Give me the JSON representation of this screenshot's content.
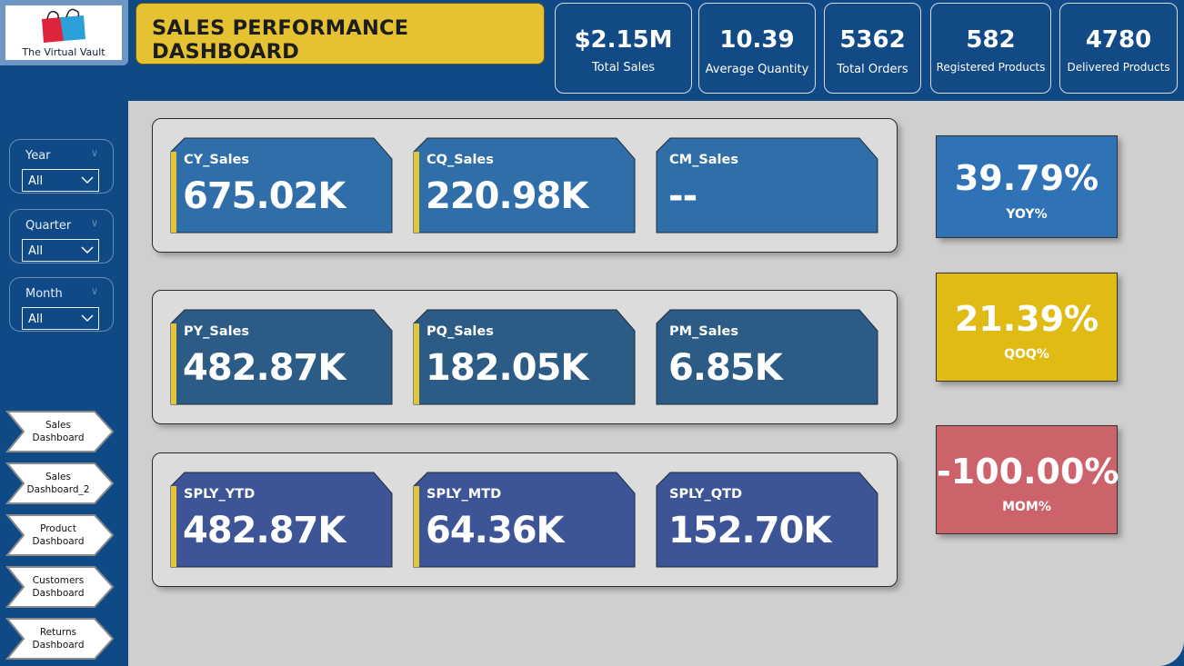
{
  "brand": {
    "name": "The Virtual Vault"
  },
  "title": "SALES PERFORMANCE DASHBOARD",
  "kpis": [
    {
      "value": "$2.15M",
      "label": "Total Sales"
    },
    {
      "value": "10.39",
      "label": "Average Quantity"
    },
    {
      "value": "5362",
      "label": "Total Orders"
    },
    {
      "value": "582",
      "label": "Registered Products"
    },
    {
      "value": "4780",
      "label": "Delivered Products"
    }
  ],
  "slicers": [
    {
      "title": "Year",
      "value": "All"
    },
    {
      "title": "Quarter",
      "value": "All"
    },
    {
      "title": "Month",
      "value": "All"
    }
  ],
  "nav": [
    {
      "line1": "Sales",
      "line2": "Dashboard"
    },
    {
      "line1": "Sales",
      "line2": "Dashboard_2"
    },
    {
      "line1": "Product",
      "line2": "Dashboard"
    },
    {
      "line1": "Customers",
      "line2": "Dashboard"
    },
    {
      "line1": "Returns",
      "line2": "Dashboard"
    }
  ],
  "rows": [
    {
      "cards": [
        {
          "label": "CY_Sales",
          "value": "675.02K"
        },
        {
          "label": "CQ_Sales",
          "value": "220.98K"
        },
        {
          "label": "CM_Sales",
          "value": "--"
        }
      ]
    },
    {
      "cards": [
        {
          "label": "PY_Sales",
          "value": "482.87K"
        },
        {
          "label": "PQ_Sales",
          "value": "182.05K"
        },
        {
          "label": "PM_Sales",
          "value": "6.85K"
        }
      ]
    },
    {
      "cards": [
        {
          "label": "SPLY_YTD",
          "value": "482.87K"
        },
        {
          "label": "SPLY_MTD",
          "value": "64.36K"
        },
        {
          "label": "SPLY_QTD",
          "value": "152.70K"
        }
      ]
    }
  ],
  "percentages": [
    {
      "value": "39.79%",
      "label": "YOY%"
    },
    {
      "value": "21.39%",
      "label": "QOQ%"
    },
    {
      "value": "-100.00%",
      "label": "MOM%"
    }
  ],
  "colors": {
    "background": "#104a86",
    "title_bg": "#e5c232",
    "row1_card": "#2f6ea8",
    "row2_card": "#2c5b86",
    "row3_card": "#3d5597",
    "card_accent": "#e3c53a",
    "yoy": "#2f72b5",
    "qoq": "#e0bb14",
    "mom": "#cc626a"
  }
}
